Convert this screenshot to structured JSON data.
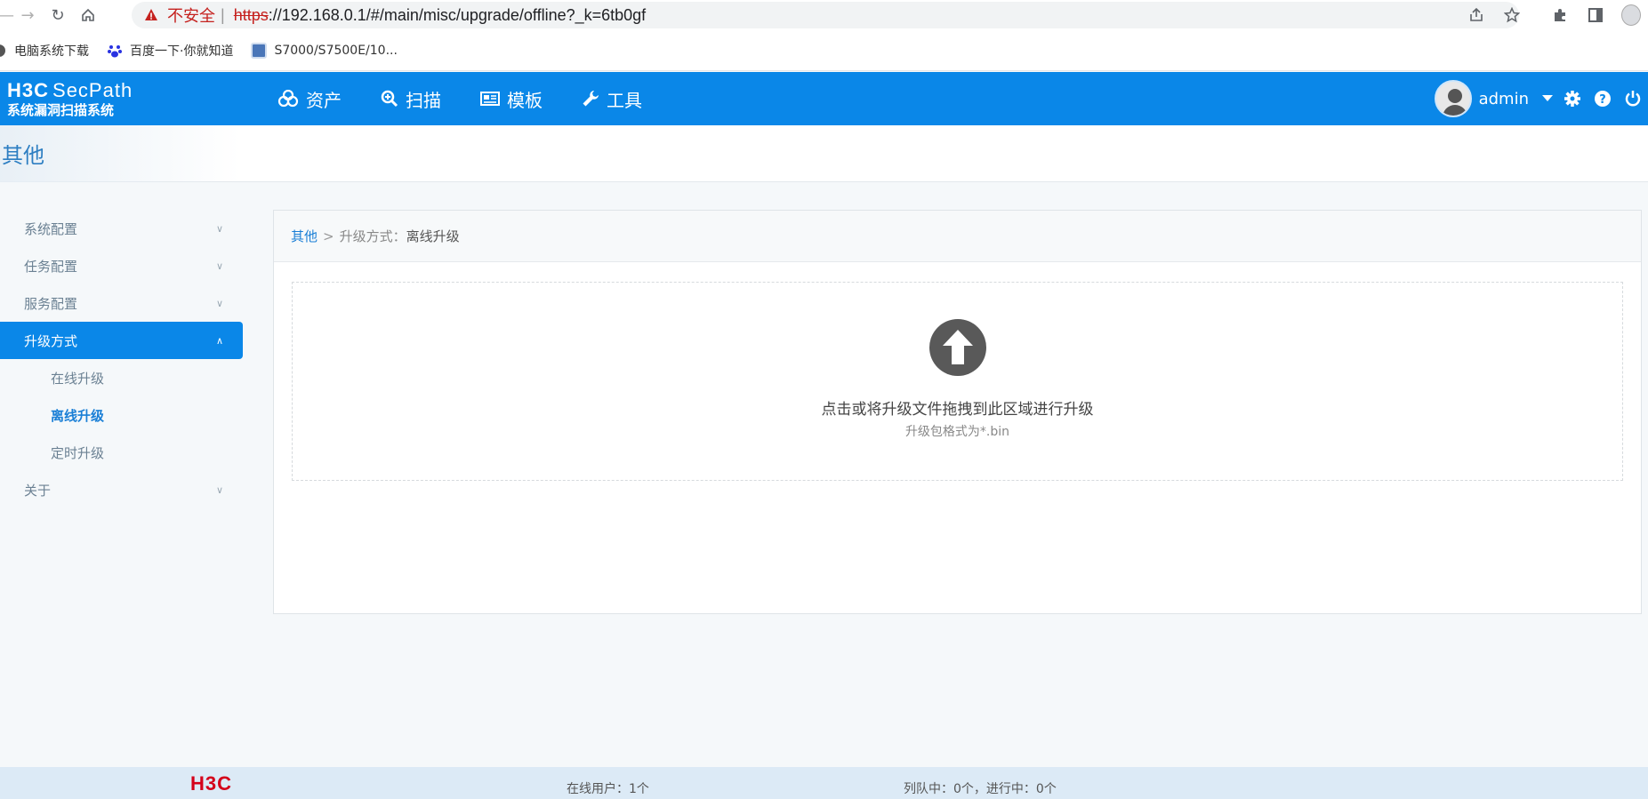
{
  "browser": {
    "security_label": "不安全",
    "url_scheme": "https",
    "url_rest": "://192.168.0.1/#/main/misc/upgrade/offline?_k=6tb0gf",
    "bookmarks": [
      {
        "label": "电脑系统下载"
      },
      {
        "label": "百度一下·你就知道"
      },
      {
        "label": "S7000/S7500E/10..."
      }
    ]
  },
  "header": {
    "logo_brand": "H3C",
    "logo_product": "SecPath",
    "logo_subtitle": "系统漏洞扫描系统",
    "nav": [
      {
        "label": "资产",
        "icon": "assets-icon"
      },
      {
        "label": "扫描",
        "icon": "scan-icon"
      },
      {
        "label": "模板",
        "icon": "template-icon"
      },
      {
        "label": "工具",
        "icon": "wrench-icon"
      }
    ],
    "username": "admin",
    "accent": "#0a87e8"
  },
  "page": {
    "title": "其他"
  },
  "sidebar": {
    "items": [
      {
        "label": "系统配置"
      },
      {
        "label": "任务配置"
      },
      {
        "label": "服务配置"
      },
      {
        "label": "升级方式",
        "expanded": true
      },
      {
        "label": "关于"
      }
    ],
    "sub_items": [
      {
        "label": "在线升级"
      },
      {
        "label": "离线升级",
        "current": true
      },
      {
        "label": "定时升级"
      }
    ]
  },
  "main": {
    "breadcrumb": {
      "root": "其他",
      "separator": ">",
      "label": "升级方式：",
      "current": "离线升级"
    },
    "dropzone": {
      "text": "点击或将升级文件拖拽到此区域进行升级",
      "hint": "升级包格式为*.bin"
    }
  },
  "footer": {
    "logo": "H3C",
    "online_users": "在线用户：1个",
    "queue_status": "列队中：0个，进行中：0个"
  }
}
